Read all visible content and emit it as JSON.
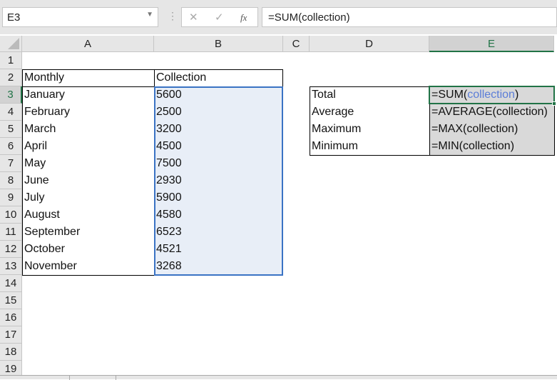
{
  "formula_bar": {
    "name_box": "E3",
    "cancel_icon": "✕",
    "enter_icon": "✓",
    "fx_icon": "fx",
    "formula": "=SUM(collection)"
  },
  "columns": [
    "A",
    "B",
    "C",
    "D",
    "E"
  ],
  "selected_column": "E",
  "rows": [
    "1",
    "2",
    "3",
    "4",
    "5",
    "6",
    "7",
    "8",
    "9",
    "10",
    "11",
    "12",
    "13",
    "14",
    "15",
    "16",
    "17",
    "18",
    "19"
  ],
  "selected_row": "3",
  "table": {
    "headers": [
      "Monthly",
      "Collection"
    ],
    "rows": [
      [
        "January",
        "5600"
      ],
      [
        "February",
        "2500"
      ],
      [
        "March",
        "3200"
      ],
      [
        "April",
        "4500"
      ],
      [
        "May",
        "7500"
      ],
      [
        "June",
        "2930"
      ],
      [
        "July",
        "5900"
      ],
      [
        "August",
        "4580"
      ],
      [
        "September",
        "6523"
      ],
      [
        "October",
        "4521"
      ],
      [
        "November",
        "3268"
      ]
    ]
  },
  "summary": [
    {
      "label": "Total",
      "formula_prefix": "=SUM(",
      "formula_ref": "collection",
      "formula_suffix": ")"
    },
    {
      "label": "Average",
      "formula": "=AVERAGE(collection)"
    },
    {
      "label": "Maximum",
      "formula": "=MAX(collection)"
    },
    {
      "label": "Minimum",
      "formula": "=MIN(collection)"
    }
  ],
  "colors": {
    "accent": "#217346",
    "range_fill": "#e8eef7",
    "range_border": "#3a73c4",
    "ref": "#5b7dd8",
    "formula_fill": "#d9d9d9"
  }
}
